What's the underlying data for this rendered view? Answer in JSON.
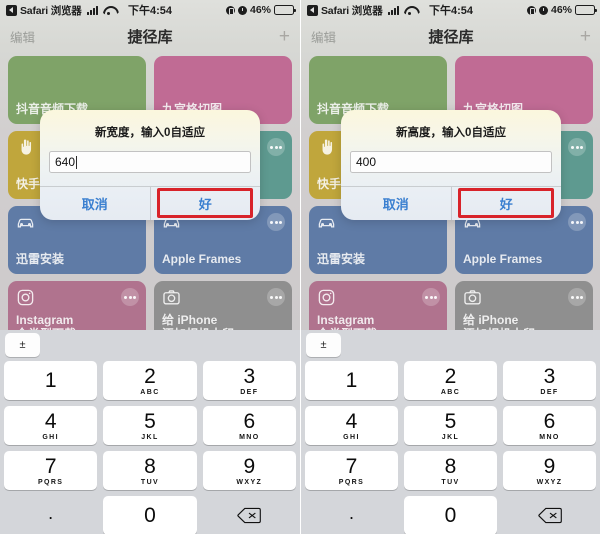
{
  "statusbar": {
    "back_label": "Safari 浏览器",
    "back_icon": "back-chevron-icon",
    "signal_icon": "cellular-signal-icon",
    "wifi_icon": "wifi-icon",
    "time": "下午4:54",
    "location_icon": "location-arrow-icon",
    "alarm_icon": "alarm-clock-icon",
    "battery_percent": "46%",
    "battery_level": 46
  },
  "navbar": {
    "edit_label": "编辑",
    "title": "捷径库",
    "add_label": "+"
  },
  "cards": [
    {
      "label": "抖音音频下载",
      "color": "#7fa368",
      "icon": "none",
      "dots": false
    },
    {
      "label": "九宫格切图",
      "color": "#c06b94",
      "icon": "none",
      "dots": false
    },
    {
      "label": "快手",
      "color": "#c0a63c",
      "icon": "hand-icon",
      "dots": false
    },
    {
      "label": "",
      "color": "#5e9a90",
      "icon": "scissors-icon",
      "dots": true
    },
    {
      "label": "迅雷安装",
      "color": "#5f7ba6",
      "icon": "car-icon",
      "dots": false
    },
    {
      "label": "Apple Frames",
      "color": "#5f7ba6",
      "icon": "car-icon",
      "dots": true
    },
    {
      "label": "Instagram\n全类型下载",
      "color": "#b0738e",
      "icon": "instagram-icon",
      "dots": true
    },
    {
      "label": "给 iPhone\n添加相机水印",
      "color": "#8f8f8f",
      "icon": "camera-icon",
      "dots": true
    }
  ],
  "panels": [
    {
      "dialog": {
        "title": "新宽度，输入0自适应",
        "value": "640",
        "placeholder": "",
        "cancel_label": "取消",
        "ok_label": "好",
        "highlight_color": "#d8232a"
      }
    },
    {
      "dialog": {
        "title": "新高度，输入0自适应",
        "value": "400",
        "placeholder": "",
        "cancel_label": "取消",
        "ok_label": "好",
        "highlight_color": "#d8232a"
      }
    }
  ],
  "keyboard": {
    "toolbar_key": "±",
    "keys": [
      {
        "num": "1",
        "sub": ""
      },
      {
        "num": "2",
        "sub": "ABC"
      },
      {
        "num": "3",
        "sub": "DEF"
      },
      {
        "num": "4",
        "sub": "GHI"
      },
      {
        "num": "5",
        "sub": "JKL"
      },
      {
        "num": "6",
        "sub": "MNO"
      },
      {
        "num": "7",
        "sub": "PQRS"
      },
      {
        "num": "8",
        "sub": "TUV"
      },
      {
        "num": "9",
        "sub": "WXYZ"
      }
    ],
    "period_key": ".",
    "zero_key": "0",
    "delete_icon": "backspace-icon"
  }
}
